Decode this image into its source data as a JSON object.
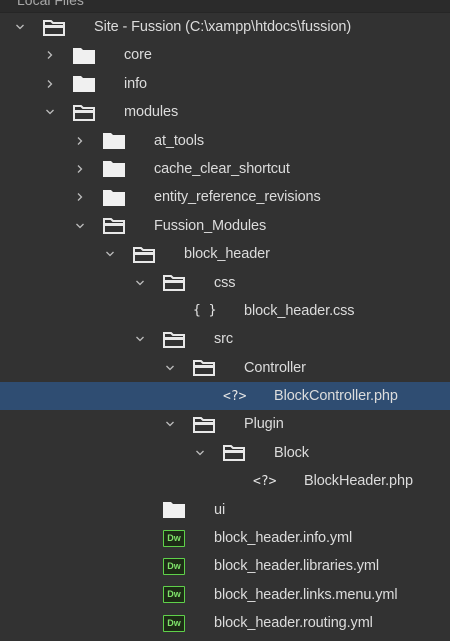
{
  "panel": {
    "title": "Local Files"
  },
  "tree": [
    {
      "label": "Site - Fussion (C:\\xampp\\htdocs\\fussion)",
      "icon": "folder-open-icon",
      "expanded": true,
      "depth": 0
    },
    {
      "label": "core",
      "icon": "folder-closed-icon",
      "expanded": false,
      "depth": 1
    },
    {
      "label": "info",
      "icon": "folder-closed-icon",
      "expanded": false,
      "depth": 1
    },
    {
      "label": "modules",
      "icon": "folder-open-icon",
      "expanded": true,
      "depth": 1
    },
    {
      "label": "at_tools",
      "icon": "folder-closed-icon",
      "expanded": false,
      "depth": 2
    },
    {
      "label": "cache_clear_shortcut",
      "icon": "folder-closed-icon",
      "expanded": false,
      "depth": 2
    },
    {
      "label": "entity_reference_revisions",
      "icon": "folder-closed-icon",
      "expanded": false,
      "depth": 2
    },
    {
      "label": "Fussion_Modules",
      "icon": "folder-open-icon",
      "expanded": true,
      "depth": 2
    },
    {
      "label": "block_header",
      "icon": "folder-open-icon",
      "expanded": true,
      "depth": 3
    },
    {
      "label": "css",
      "icon": "folder-open-icon",
      "expanded": true,
      "depth": 4
    },
    {
      "label": "block_header.css",
      "icon": "css-file-icon",
      "glyph": "{ }",
      "depth": 5
    },
    {
      "label": "src",
      "icon": "folder-open-icon",
      "expanded": true,
      "depth": 4
    },
    {
      "label": "Controller",
      "icon": "folder-open-icon",
      "expanded": true,
      "depth": 5
    },
    {
      "label": "BlockController.php",
      "icon": "php-file-icon",
      "glyph": "<?>",
      "depth": 6,
      "selected": true
    },
    {
      "label": "Plugin",
      "icon": "folder-open-icon",
      "expanded": true,
      "depth": 5
    },
    {
      "label": "Block",
      "icon": "folder-open-icon",
      "expanded": true,
      "depth": 6
    },
    {
      "label": "BlockHeader.php",
      "icon": "php-file-icon",
      "glyph": "<?>",
      "depth": 7
    },
    {
      "label": "ui",
      "icon": "folder-closed-icon",
      "depth": 4
    },
    {
      "label": "block_header.info.yml",
      "icon": "dreamweaver-file-icon",
      "glyph": "Dw",
      "depth": 4
    },
    {
      "label": "block_header.libraries.yml",
      "icon": "dreamweaver-file-icon",
      "glyph": "Dw",
      "depth": 4
    },
    {
      "label": "block_header.links.menu.yml",
      "icon": "dreamweaver-file-icon",
      "glyph": "Dw",
      "depth": 4
    },
    {
      "label": "block_header.routing.yml",
      "icon": "dreamweaver-file-icon",
      "glyph": "Dw",
      "depth": 4
    }
  ],
  "colors": {
    "background": "#323232",
    "selected_row": "#2f4d72",
    "text": "#dcdcdc",
    "dreamweaver_green": "#5fd14a"
  }
}
